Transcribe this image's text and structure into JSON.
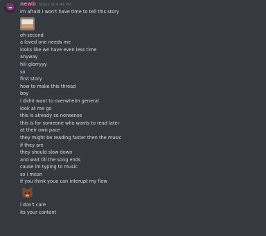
{
  "message": {
    "username": "newb",
    "timestamp": "Today at 4:44 PM",
    "avatar_icon": "user-avatar",
    "before_emoji": [
      "im afraid i won't have time to tell this story"
    ],
    "emoji_1": "cake-emoji",
    "middle": [
      "oh second",
      "a loved one needs me",
      "looks like we have even less time",
      "anyway",
      "hiii glorryyy",
      "so",
      "first story",
      "how to make this thread",
      "boy",
      "i didnt want to overwhelm general",
      "look at me go",
      "this is already so nonsense",
      "this is for someone who wants to read later",
      "at their own pace",
      "they might be reading faster then the music",
      "if they are",
      "they should slow down",
      "and wait till the song ends",
      "cause im typing to music",
      "so i mean",
      "if you think youo can interupt my flow"
    ],
    "emoji_2": "bear-emoji",
    "after_emoji": [
      "i don't care",
      "its your content"
    ]
  },
  "colors": {
    "background": "#36393f",
    "username": "#e9739a",
    "text": "#dcddde",
    "timestamp": "#72767d"
  }
}
